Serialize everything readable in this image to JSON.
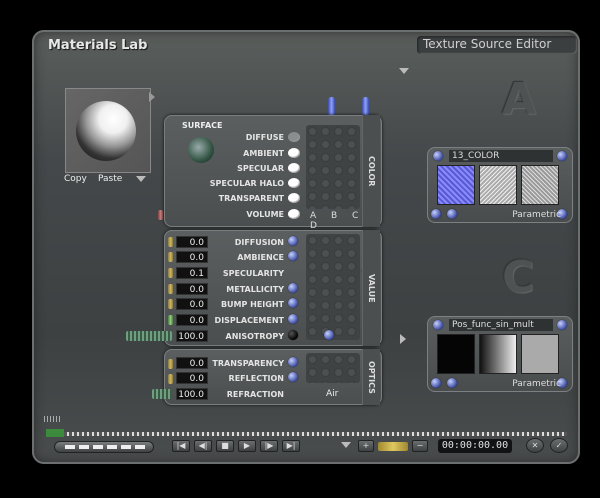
{
  "window": {
    "title": "Materials Lab",
    "editor_title": "Texture Source Editor"
  },
  "preview": {
    "copy_label": "Copy",
    "paste_label": "Paste"
  },
  "surface": {
    "header": "SURFACE",
    "tab_label": "COLOR",
    "columns": "A B C D",
    "rows": [
      {
        "label": "DIFFUSE",
        "on": false
      },
      {
        "label": "AMBIENT",
        "on": true
      },
      {
        "label": "SPECULAR",
        "on": true
      },
      {
        "label": "SPECULAR HALO",
        "on": true
      },
      {
        "label": "TRANSPARENT",
        "on": true
      },
      {
        "label": "VOLUME",
        "on": true
      }
    ]
  },
  "value": {
    "tab_label": "VALUE",
    "rows": [
      {
        "label": "DIFFUSION",
        "value": "0.0"
      },
      {
        "label": "AMBIENCE",
        "value": "0.0"
      },
      {
        "label": "SPECULARITY",
        "value": "0.1"
      },
      {
        "label": "METALLICITY",
        "value": "0.0"
      },
      {
        "label": "BUMP HEIGHT",
        "value": "0.0"
      },
      {
        "label": "DISPLACEMENT",
        "value": "0.0"
      },
      {
        "label": "ANISOTROPY",
        "value": "100.0"
      }
    ]
  },
  "optics": {
    "tab_label": "OPTICS",
    "rows": [
      {
        "label": "TRANSPARENCY",
        "value": "0.0"
      },
      {
        "label": "REFLECTION",
        "value": "0.0"
      },
      {
        "label": "REFRACTION",
        "value": "100.0"
      }
    ],
    "medium": "Air"
  },
  "textures": [
    {
      "slot": "A",
      "name": "13_COLOR",
      "type": "Parametric"
    },
    {
      "slot": "C",
      "name": "Pos_func_sin_mult",
      "type": "Parametric"
    }
  ],
  "transport": {
    "timecode": "00:00:00.00"
  },
  "colors": {
    "accent_blue": "#3b4aa0",
    "frame": "#44484a"
  }
}
